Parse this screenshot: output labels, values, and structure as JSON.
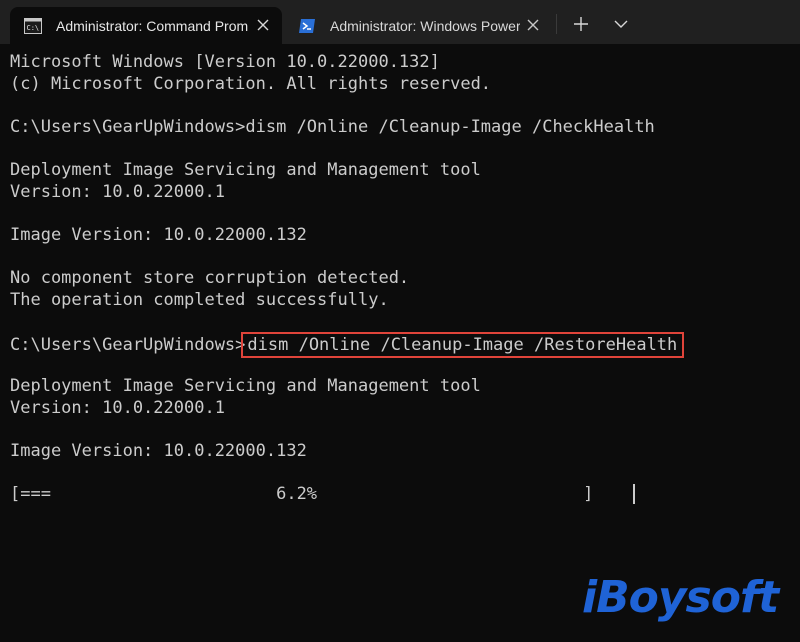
{
  "tabs": [
    {
      "label": "Administrator: Command Prompt",
      "icon": "command-prompt-icon"
    },
    {
      "label": "Administrator: Windows PowerShell",
      "icon": "powershell-icon"
    }
  ],
  "console": {
    "lines": [
      "Microsoft Windows [Version 10.0.22000.132]",
      "(c) Microsoft Corporation. All rights reserved.",
      "C:\\Users\\GearUpWindows>dism /Online /Cleanup-Image /CheckHealth",
      "Deployment Image Servicing and Management tool",
      "Version: 10.0.22000.1",
      "Image Version: 10.0.22000.132",
      "No component store corruption detected.",
      "The operation completed successfully.",
      "Deployment Image Servicing and Management tool",
      "Version: 10.0.22000.1",
      "Image Version: 10.0.22000.132"
    ],
    "prompt": "C:\\Users\\GearUpWindows>",
    "highlighted_command": "dism /Online /Cleanup-Image /RestoreHealth",
    "progress": {
      "text": "[===                      6.2%                          ]",
      "percent": 6.2
    }
  },
  "watermark": "iBoysoft",
  "colors": {
    "background": "#0c0c0c",
    "text": "#cccccc",
    "highlight_border": "#e0443a",
    "watermark": "#1f63d6"
  }
}
